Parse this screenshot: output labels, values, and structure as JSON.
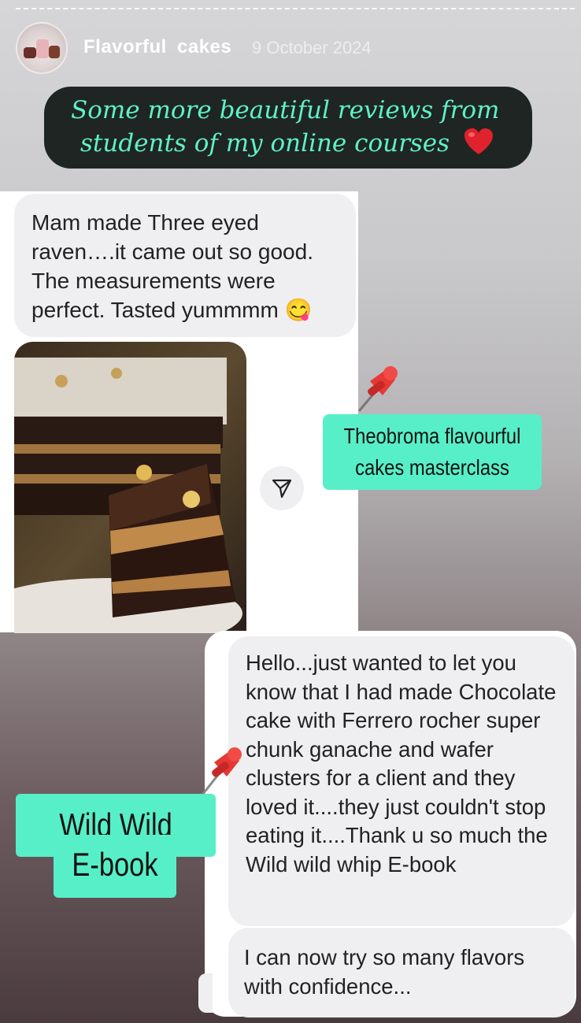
{
  "story": {
    "account_name": "Flavorful  cakes",
    "date": "9 October 2024",
    "headline_line1": "Some more beautiful reviews from",
    "headline_line2": "students of my online courses",
    "heart_icon": "red-heart-emoji"
  },
  "review1": {
    "message": "Mam made Three eyed raven….it came out so good. The measurements were perfect. Tasted yummmm 😋",
    "image_alt": "chocolate cake slice with caramel layers",
    "share_icon": "paper-plane-icon",
    "tag_line1": "Theobroma flavourful",
    "tag_line2": "cakes masterclass",
    "pin_icon": "pushpin-icon"
  },
  "review2": {
    "message": "Hello...just wanted to let you know that I had made Chocolate cake with Ferrero rocher super chunk ganache and wafer clusters for a client and they loved it....they just couldn't stop eating it....Thank u so much the Wild wild whip E-book",
    "followup": "I can now try so many flavors with confidence...",
    "tag_line1": "Wild Wild Whip",
    "tag_line2": "E-book",
    "pin_icon": "pushpin-icon"
  },
  "colors": {
    "tag_accent": "#57efc8",
    "headline_text": "#5ff0c8",
    "headline_bg": "#1f2522",
    "bubble_bg": "#efeff1"
  }
}
